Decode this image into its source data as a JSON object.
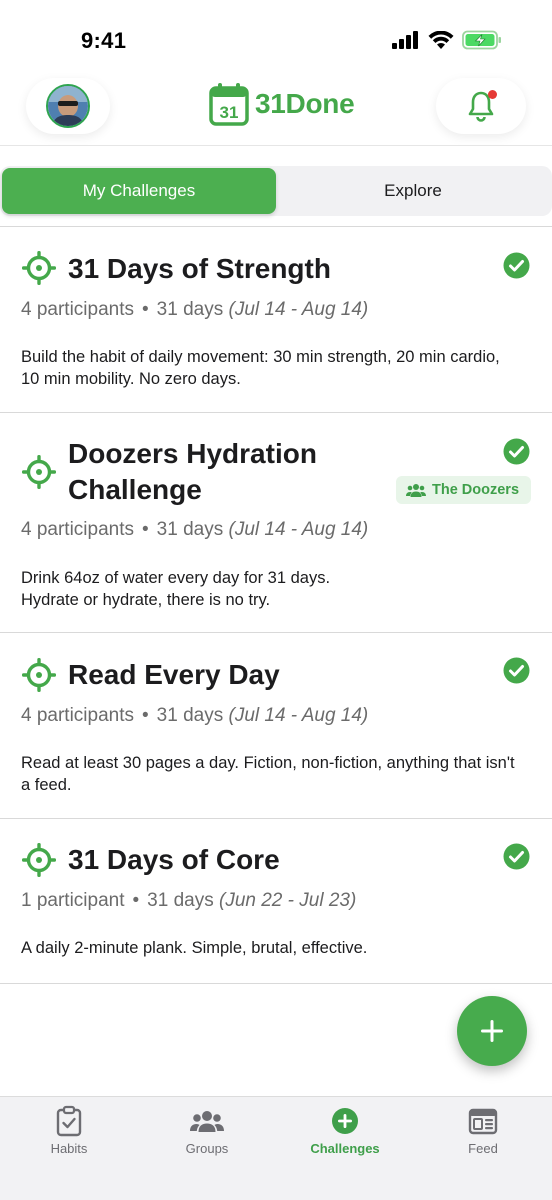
{
  "status_bar": {
    "time": "9:41"
  },
  "header": {
    "app_name": "31Done",
    "logo_calendar_number": "31"
  },
  "tabs": {
    "my_challenges": "My Challenges",
    "explore": "Explore",
    "active": "My Challenges"
  },
  "challenges": [
    {
      "title": "31 Days of Strength",
      "participants": "4 participants",
      "duration": "31 days",
      "dates": "(Jul 14 - Aug 14)",
      "description": "Build the habit of daily movement: 30 min strength, 20 min cardio, 10 min mobility. No zero days.",
      "completed": true
    },
    {
      "title": "Doozers Hydration Challenge",
      "participants": "4 participants",
      "duration": "31 days",
      "dates": "(Jul 14 - Aug 14)",
      "description_line1": "Drink 64oz of water every day for 31 days.",
      "description_line2": "Hydrate or hydrate, there is no try.",
      "group": "The Doozers",
      "completed": true
    },
    {
      "title": "Read Every Day",
      "participants": "4 participants",
      "duration": "31 days",
      "dates": "(Jul 14 - Aug 14)",
      "description": "Read at least 30 pages a day. Fiction, non-fiction, anything that isn't a feed.",
      "completed": true
    },
    {
      "title": "31 Days of Core",
      "participants": "1 participant",
      "duration": "31 days",
      "dates": "(Jun 22 - Jul 23)",
      "description": "A daily 2-minute plank. Simple, brutal, effective.",
      "completed": true
    }
  ],
  "separator": "•",
  "fab": {
    "icon": "plus-icon"
  },
  "tabbar": {
    "items": [
      {
        "label": "Habits",
        "icon": "clipboard-check-icon"
      },
      {
        "label": "Groups",
        "icon": "people-icon"
      },
      {
        "label": "Challenges",
        "icon": "plus-circle-icon"
      },
      {
        "label": "Feed",
        "icon": "newspaper-icon"
      }
    ],
    "active": "Challenges"
  },
  "colors": {
    "brand_green": "#44a84a",
    "active_segment": "#4caf50",
    "badge_bg": "#e8f5e9",
    "notification_dot": "#e53935"
  }
}
